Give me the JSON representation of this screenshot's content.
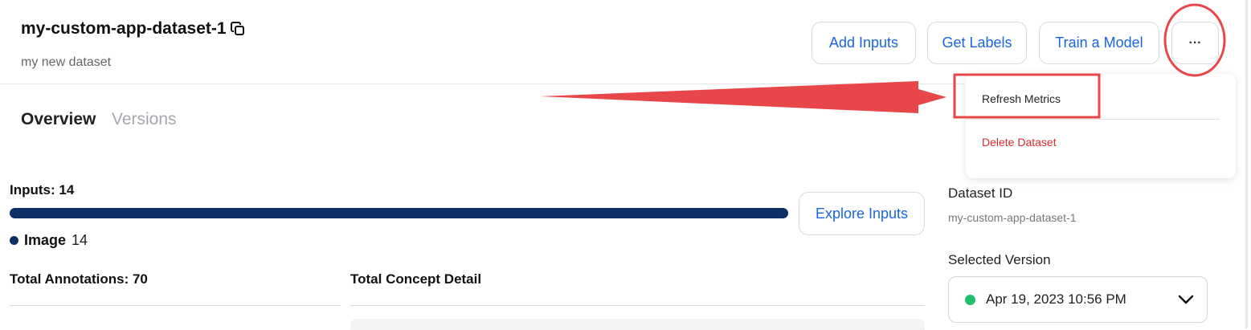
{
  "header": {
    "title": "my-custom-app-dataset-1",
    "subtitle": "my new dataset",
    "buttons": {
      "add_inputs": "Add Inputs",
      "get_labels": "Get Labels",
      "train_model": "Train a Model",
      "more": "···"
    }
  },
  "menu": {
    "refresh": "Refresh Metrics",
    "delete": "Delete Dataset"
  },
  "tabs": [
    {
      "label": "Overview",
      "active": true
    },
    {
      "label": "Versions",
      "active": false
    }
  ],
  "inputs": {
    "label": "Inputs: 14",
    "explore_button": "Explore Inputs",
    "progress": 1.0,
    "legend_label": "Image",
    "legend_count": "14"
  },
  "annotations": {
    "total_label": "Total Annotations: 70",
    "concept_label": "Total Concept Detail"
  },
  "sidebar": {
    "dataset_id_label": "Dataset ID",
    "dataset_id_value": "my-custom-app-dataset-1",
    "version_label": "Selected Version",
    "version_value": "Apr 19, 2023 10:56 PM"
  },
  "colors": {
    "accent": "#1a66e0",
    "progress": "#0c2f66",
    "delete": "#d92c2c",
    "status_dot": "#1fbf6b",
    "annotation": "#e8474a"
  },
  "icons": [
    "copy-icon",
    "chevron-down-icon",
    "status-dot-icon"
  ]
}
